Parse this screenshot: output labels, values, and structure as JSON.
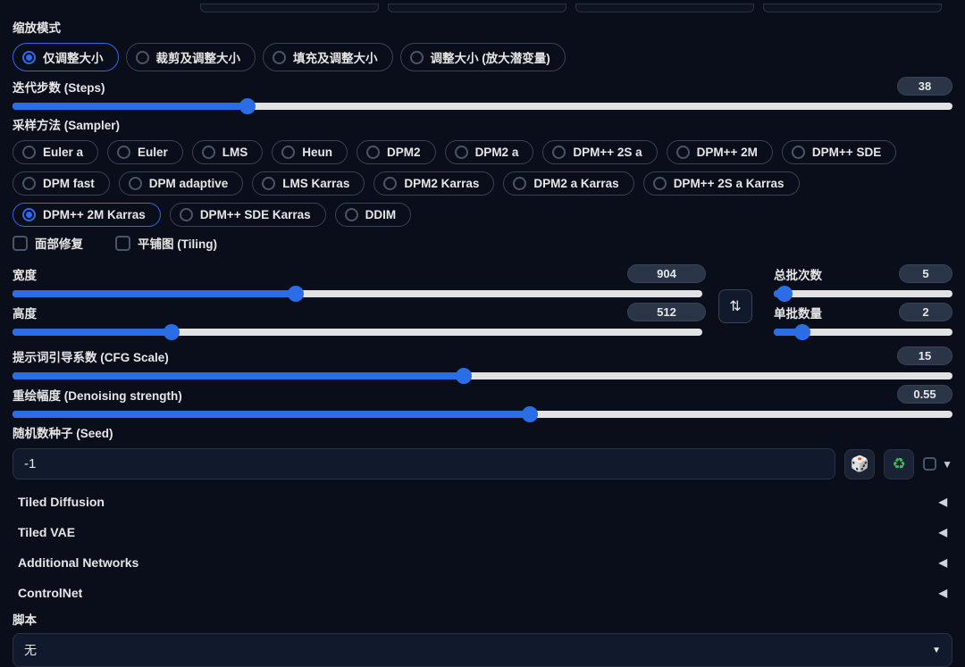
{
  "resizeMode": {
    "label": "缩放模式",
    "selected": 0,
    "options": [
      "仅调整大小",
      "裁剪及调整大小",
      "填充及调整大小",
      "调整大小 (放大潜变量)"
    ]
  },
  "steps": {
    "label": "迭代步数 (Steps)",
    "value": 38,
    "min": 1,
    "max": 150,
    "percent": 25
  },
  "sampler": {
    "label": "采样方法 (Sampler)",
    "selected": "DPM++ 2M Karras",
    "options": [
      "Euler a",
      "Euler",
      "LMS",
      "Heun",
      "DPM2",
      "DPM2 a",
      "DPM++ 2S a",
      "DPM++ 2M",
      "DPM++ SDE",
      "DPM fast",
      "DPM adaptive",
      "LMS Karras",
      "DPM2 Karras",
      "DPM2 a Karras",
      "DPM++ 2S a Karras",
      "DPM++ 2M Karras",
      "DPM++ SDE Karras",
      "DDIM"
    ]
  },
  "checkboxes": {
    "faceRestore": {
      "label": "面部修复",
      "checked": false
    },
    "tiling": {
      "label": "平铺图 (Tiling)",
      "checked": false
    }
  },
  "width": {
    "label": "宽度",
    "value": 904,
    "percent": 41
  },
  "height": {
    "label": "高度",
    "value": 512,
    "percent": 23
  },
  "batchCount": {
    "label": "总批次数",
    "value": 5,
    "percent": 6
  },
  "batchSize": {
    "label": "单批数量",
    "value": 2,
    "percent": 16
  },
  "swapLabel": "⇅",
  "cfg": {
    "label": "提示词引导系数 (CFG Scale)",
    "value": 15,
    "percent": 48
  },
  "denoise": {
    "label": "重绘幅度 (Denoising strength)",
    "value": "0.55",
    "percent": 55
  },
  "seed": {
    "label": "随机数种子 (Seed)",
    "value": "-1",
    "diceIcon": "🎲",
    "recycleIcon": "♻"
  },
  "accordions": [
    "Tiled Diffusion",
    "Tiled VAE",
    "Additional Networks",
    "ControlNet"
  ],
  "script": {
    "label": "脚本",
    "value": "无"
  }
}
